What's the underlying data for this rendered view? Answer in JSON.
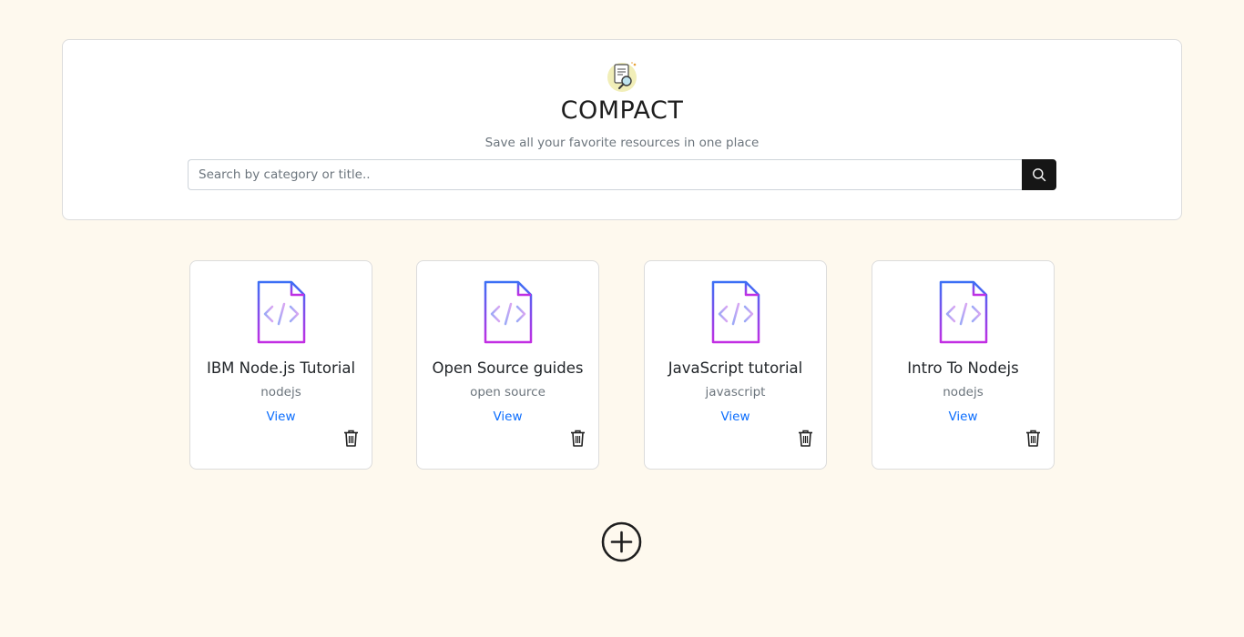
{
  "header": {
    "title": "COMPACT",
    "subtitle": "Save all your favorite resources in one place",
    "logo_icon": "document-magnifier-icon"
  },
  "search": {
    "placeholder": "Search by category or title..",
    "value": "",
    "button_icon": "search-icon"
  },
  "cards": [
    {
      "title": "IBM Node.js Tutorial",
      "category": "nodejs",
      "view_label": "View",
      "icon": "code-file-icon",
      "delete_icon": "trash-icon"
    },
    {
      "title": "Open Source guides",
      "category": "open source",
      "view_label": "View",
      "icon": "code-file-icon",
      "delete_icon": "trash-icon"
    },
    {
      "title": "JavaScript tutorial",
      "category": "javascript",
      "view_label": "View",
      "icon": "code-file-icon",
      "delete_icon": "trash-icon"
    },
    {
      "title": "Intro To Nodejs",
      "category": "nodejs",
      "view_label": "View",
      "icon": "code-file-icon",
      "delete_icon": "trash-icon"
    }
  ],
  "add_button": {
    "icon": "plus-circle-icon"
  },
  "colors": {
    "page_background": "#fef9ee",
    "card_background": "#ffffff",
    "link": "#0d6efd",
    "search_button": "#161616",
    "icon_gradient_top": "#3b82f6",
    "icon_gradient_bottom": "#c026d3"
  }
}
